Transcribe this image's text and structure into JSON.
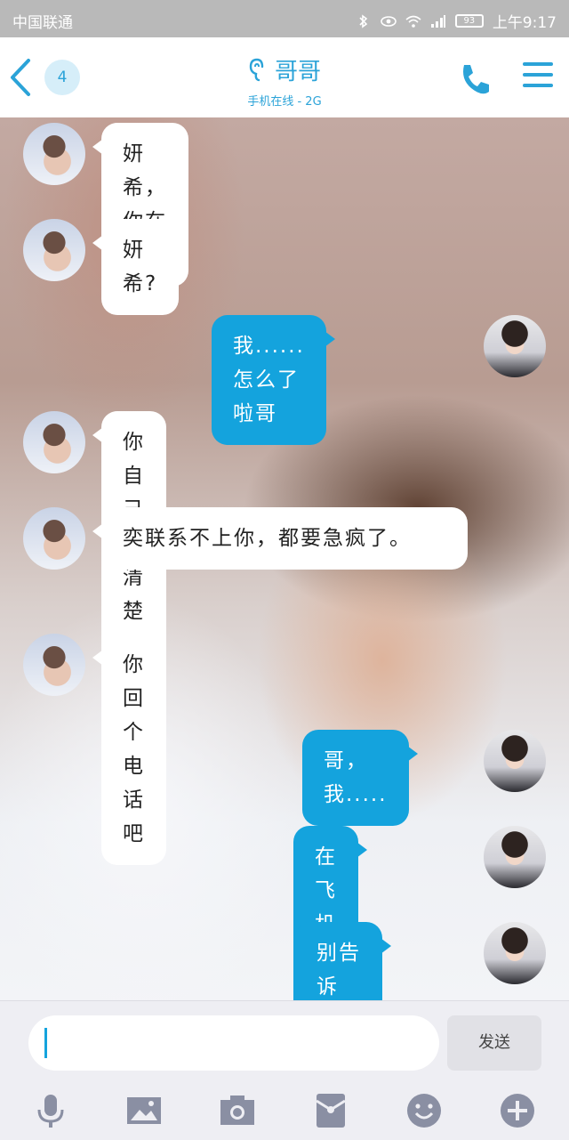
{
  "status_bar": {
    "carrier": "中国联通",
    "battery": "93",
    "time": "上午9:17"
  },
  "header": {
    "unread_count": "4",
    "title": "哥哥",
    "subtitle": "手机在线 - 2G"
  },
  "messages": [
    {
      "side": "in",
      "text": "妍希，你在哪?"
    },
    {
      "side": "in",
      "text": "妍希?"
    },
    {
      "side": "out",
      "text": "我......怎么了啦哥"
    },
    {
      "side": "in",
      "text": "你自己不清楚啊"
    },
    {
      "side": "in",
      "text": "奕联系不上你，都要急疯了。"
    },
    {
      "side": "in",
      "text": "你回个电话吧"
    },
    {
      "side": "out",
      "text": "哥，我....."
    },
    {
      "side": "out",
      "text": "在飞机场✈"
    },
    {
      "side": "out",
      "text": "别告诉奕。"
    }
  ],
  "composer": {
    "placeholder": "",
    "send_label": "发送"
  },
  "colors": {
    "accent": "#2ba3d8",
    "outgoing_bubble": "#14a3dd",
    "incoming_bubble": "#ffffff"
  },
  "icons": [
    "back-icon",
    "ear-icon",
    "phone-icon",
    "menu-icon",
    "mic-icon",
    "image-icon",
    "camera-icon",
    "red-packet-icon",
    "emoji-icon",
    "plus-icon"
  ]
}
